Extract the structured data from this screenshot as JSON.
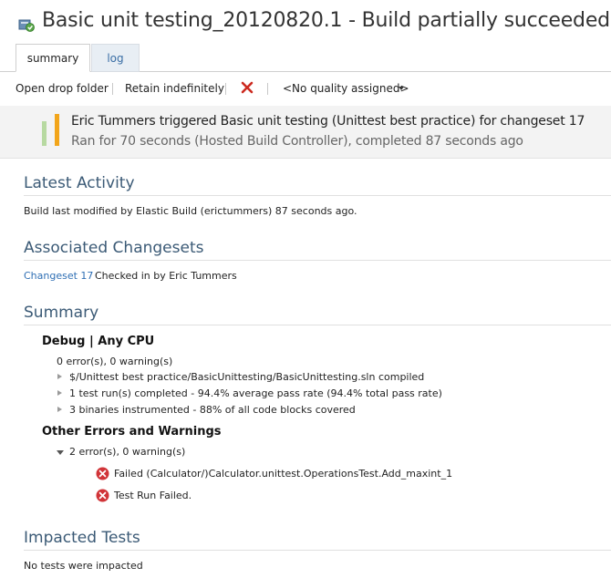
{
  "header": {
    "title": "Basic unit testing_20120820.1 - Build partially succeeded",
    "icon": "build-partial-icon"
  },
  "tabs": [
    {
      "label": "summary",
      "active": true
    },
    {
      "label": "log",
      "active": false
    }
  ],
  "toolbar": {
    "open_drop_folder": "Open drop folder",
    "retain": "Retain indefinitely",
    "delete_icon": "red-x-icon",
    "quality": "<No quality assigned>"
  },
  "status": {
    "line1": "Eric Tummers triggered Basic unit testing (Unittest best practice) for changeset 17",
    "line2": "Ran for 70 seconds (Hosted Build Controller), completed 87 seconds ago",
    "colors": {
      "partial": "#f2a51a",
      "success": "#b7d9a1"
    }
  },
  "latest_activity": {
    "heading": "Latest Activity",
    "text": "Build last modified by Elastic Build (erictummers) 87 seconds ago."
  },
  "changesets": {
    "heading": "Associated Changesets",
    "link": "Changeset 17",
    "text": "Checked in by Eric Tummers"
  },
  "summary": {
    "heading": "Summary",
    "config_heading": "Debug | Any CPU",
    "counts": "0 error(s), 0 warning(s)",
    "items": [
      "$/Unittest best practice/BasicUnittesting/BasicUnittesting.sln compiled",
      "1 test run(s) completed - 94.4% average pass rate (94.4% total pass rate)",
      "3 binaries instrumented - 88% of all code blocks covered"
    ],
    "other_heading": "Other Errors and Warnings",
    "other_counts": "2 error(s), 0 warning(s)",
    "errors": [
      "Failed (Calculator/)Calculator.unittest.OperationsTest.Add_maxint_1",
      "Test Run Failed."
    ],
    "error_color": "#d13438"
  },
  "impacted": {
    "heading": "Impacted Tests",
    "text": "No tests were impacted"
  }
}
